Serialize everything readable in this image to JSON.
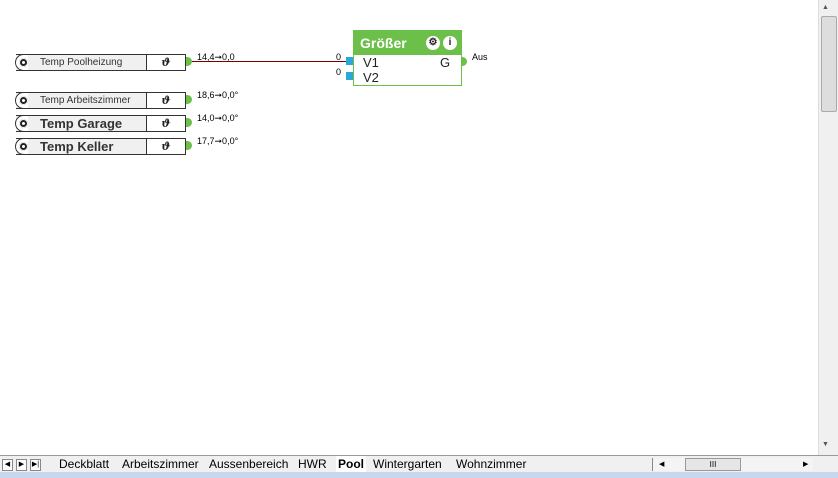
{
  "inputs": [
    {
      "label": "Temp Poolheizung",
      "symbol": "ϑ",
      "value": "14,4➞0,0",
      "size": "small"
    },
    {
      "label": "Temp Arbeitszimmer",
      "symbol": "ϑ",
      "value": "18,6➞0,0°",
      "size": "small"
    },
    {
      "label": "Temp Garage",
      "symbol": "ϑ",
      "value": "14,0➞0,0°",
      "size": "large"
    },
    {
      "label": "Temp Keller",
      "symbol": "ϑ",
      "value": "17,7➞0,0°",
      "size": "large"
    }
  ],
  "block": {
    "title": "Größer",
    "in1": "V1",
    "in2": "V2",
    "out": "G",
    "in1_value": "0",
    "in2_value": "0",
    "out_label": "Aus",
    "info_icon": "i"
  },
  "tabs": [
    "Deckblatt",
    "Arbeitszimmer",
    "Aussenbereich",
    "HWR",
    "Pool",
    "Wintergarten",
    "Wohnzimmer"
  ],
  "active_tab": "Pool",
  "hscroll_grip": "III",
  "colors": {
    "accent": "#6cc04a",
    "input_port": "#2aa8d8",
    "wire": "#7a0000"
  }
}
